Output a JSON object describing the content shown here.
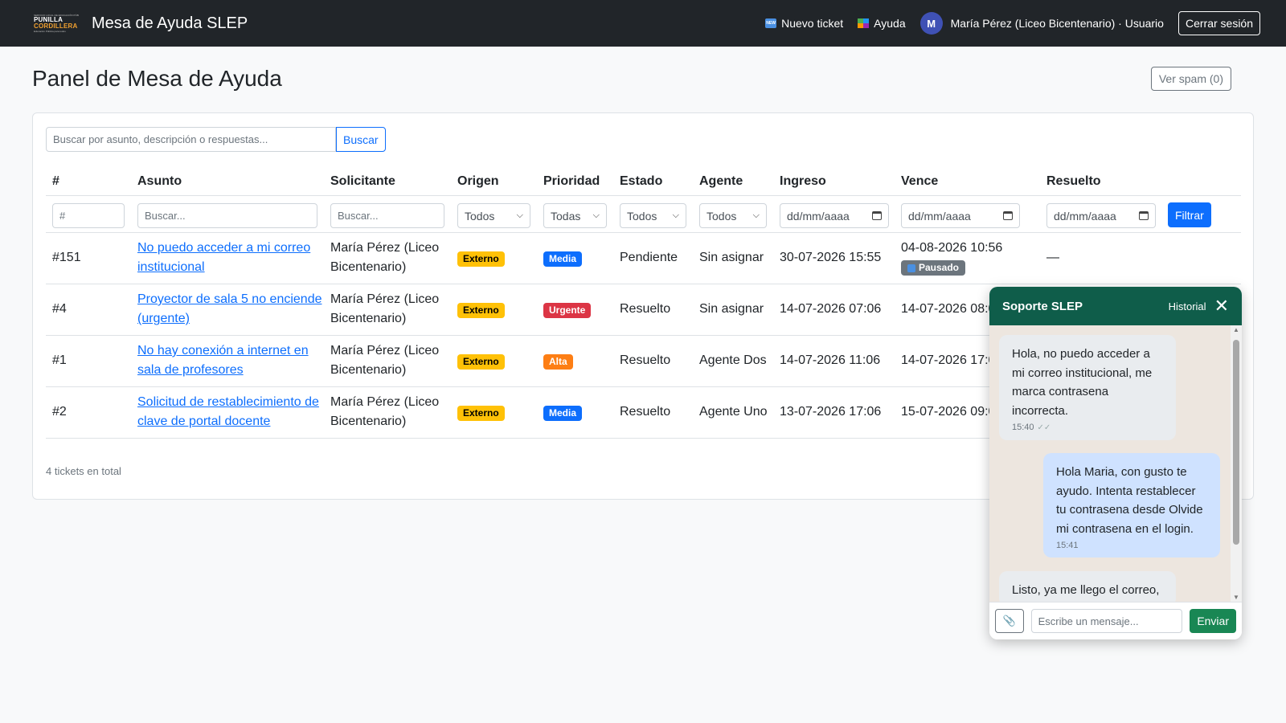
{
  "navbar": {
    "logo_line1": "SERVICIO LOCAL DE EDUCACIÓN PÚBLICA",
    "logo_line2a": "PUNILLA",
    "logo_line2b": "CORDILLERA",
    "logo_line3": "Educación Pública para todos",
    "brand": "Mesa de Ayuda SLEP",
    "new_ticket": "Nuevo ticket",
    "new_icon_text": "NEW",
    "help": "Ayuda",
    "avatar_initial": "M",
    "user": "María Pérez (Liceo Bicentenario) · Usuario",
    "logout": "Cerrar sesión"
  },
  "page": {
    "title": "Panel de Mesa de Ayuda",
    "spam_button": "Ver spam (0)"
  },
  "search": {
    "placeholder": "Buscar por asunto, descripción o respuestas...",
    "button": "Buscar"
  },
  "table": {
    "headers": [
      "#",
      "Asunto",
      "Solicitante",
      "Origen",
      "Prioridad",
      "Estado",
      "Agente",
      "Ingreso",
      "Vence",
      "Resuelto"
    ],
    "filters": {
      "id": "#",
      "asunto": "Buscar...",
      "solicitante": "Buscar...",
      "origen": "Todos",
      "prioridad": "Todas",
      "estado": "Todos",
      "agente": "Todos",
      "ingreso": "dd/mm/aaaa",
      "vence": "dd/mm/aaaa",
      "resuelto": "dd/mm/aaaa",
      "button": "Filtrar"
    },
    "rows": [
      {
        "id": "#151",
        "asunto1": "No puedo acceder a mi correo",
        "asunto2": "institucional",
        "sol1": "María Pérez (Liceo",
        "sol2": "Bicentenario)",
        "origen": "Externo",
        "prioridad": "Media",
        "estado": "Pendiente",
        "agente": "Sin asignar",
        "ingreso": "30-07-2026 15:55",
        "vence": "04-08-2026 10:56",
        "vence_badge": "Pausado",
        "resuelto": "—"
      },
      {
        "id": "#4",
        "asunto1": "Proyector de sala 5 no enciende",
        "asunto2": "(urgente)",
        "sol1": "María Pérez (Liceo",
        "sol2": "Bicentenario)",
        "origen": "Externo",
        "prioridad": "Urgente",
        "estado": "Resuelto",
        "agente": "Sin asignar",
        "ingreso": "14-07-2026 07:06",
        "vence": "14-07-2026 08:0"
      },
      {
        "id": "#1",
        "asunto1": "No hay conexión a internet en",
        "asunto2": "sala de profesores",
        "sol1": "María Pérez (Liceo",
        "sol2": "Bicentenario)",
        "origen": "Externo",
        "prioridad": "Alta",
        "estado": "Resuelto",
        "agente": "Agente Dos",
        "ingreso": "14-07-2026 11:06",
        "vence": "14-07-2026 17:0"
      },
      {
        "id": "#2",
        "asunto1": "Solicitud de restablecimiento de",
        "asunto2": "clave de portal docente",
        "sol1": "María Pérez (Liceo",
        "sol2": "Bicentenario)",
        "origen": "Externo",
        "prioridad": "Media",
        "estado": "Resuelto",
        "agente": "Agente Uno",
        "ingreso": "13-07-2026 17:06",
        "vence": "15-07-2026 09:0"
      }
    ],
    "total": "4 tickets en total"
  },
  "chat": {
    "title": "Soporte SLEP",
    "history": "Historial",
    "messages": [
      {
        "dir": "in",
        "l1": "Hola, no puedo acceder a",
        "l2": "mi correo institucional, me",
        "l3": "marca contrasena",
        "l4": "incorrecta.",
        "time": "15:40",
        "ticks": "✓✓"
      },
      {
        "dir": "out",
        "l1": "Hola Maria, con gusto te",
        "l2": "ayudo. Intenta restablecer",
        "l3": "tu contrasena desde Olvide",
        "l4": "mi contrasena en el login.",
        "time": "15:41"
      },
      {
        "dir": "in",
        "l1": "Listo, ya me llego el correo,"
      }
    ],
    "input_placeholder": "Escribe un mensaje...",
    "send": "Enviar"
  },
  "colors": {
    "navbar": "#212529",
    "primary": "#0d6efd",
    "chat_header": "#0f5d4a",
    "send": "#198754"
  }
}
